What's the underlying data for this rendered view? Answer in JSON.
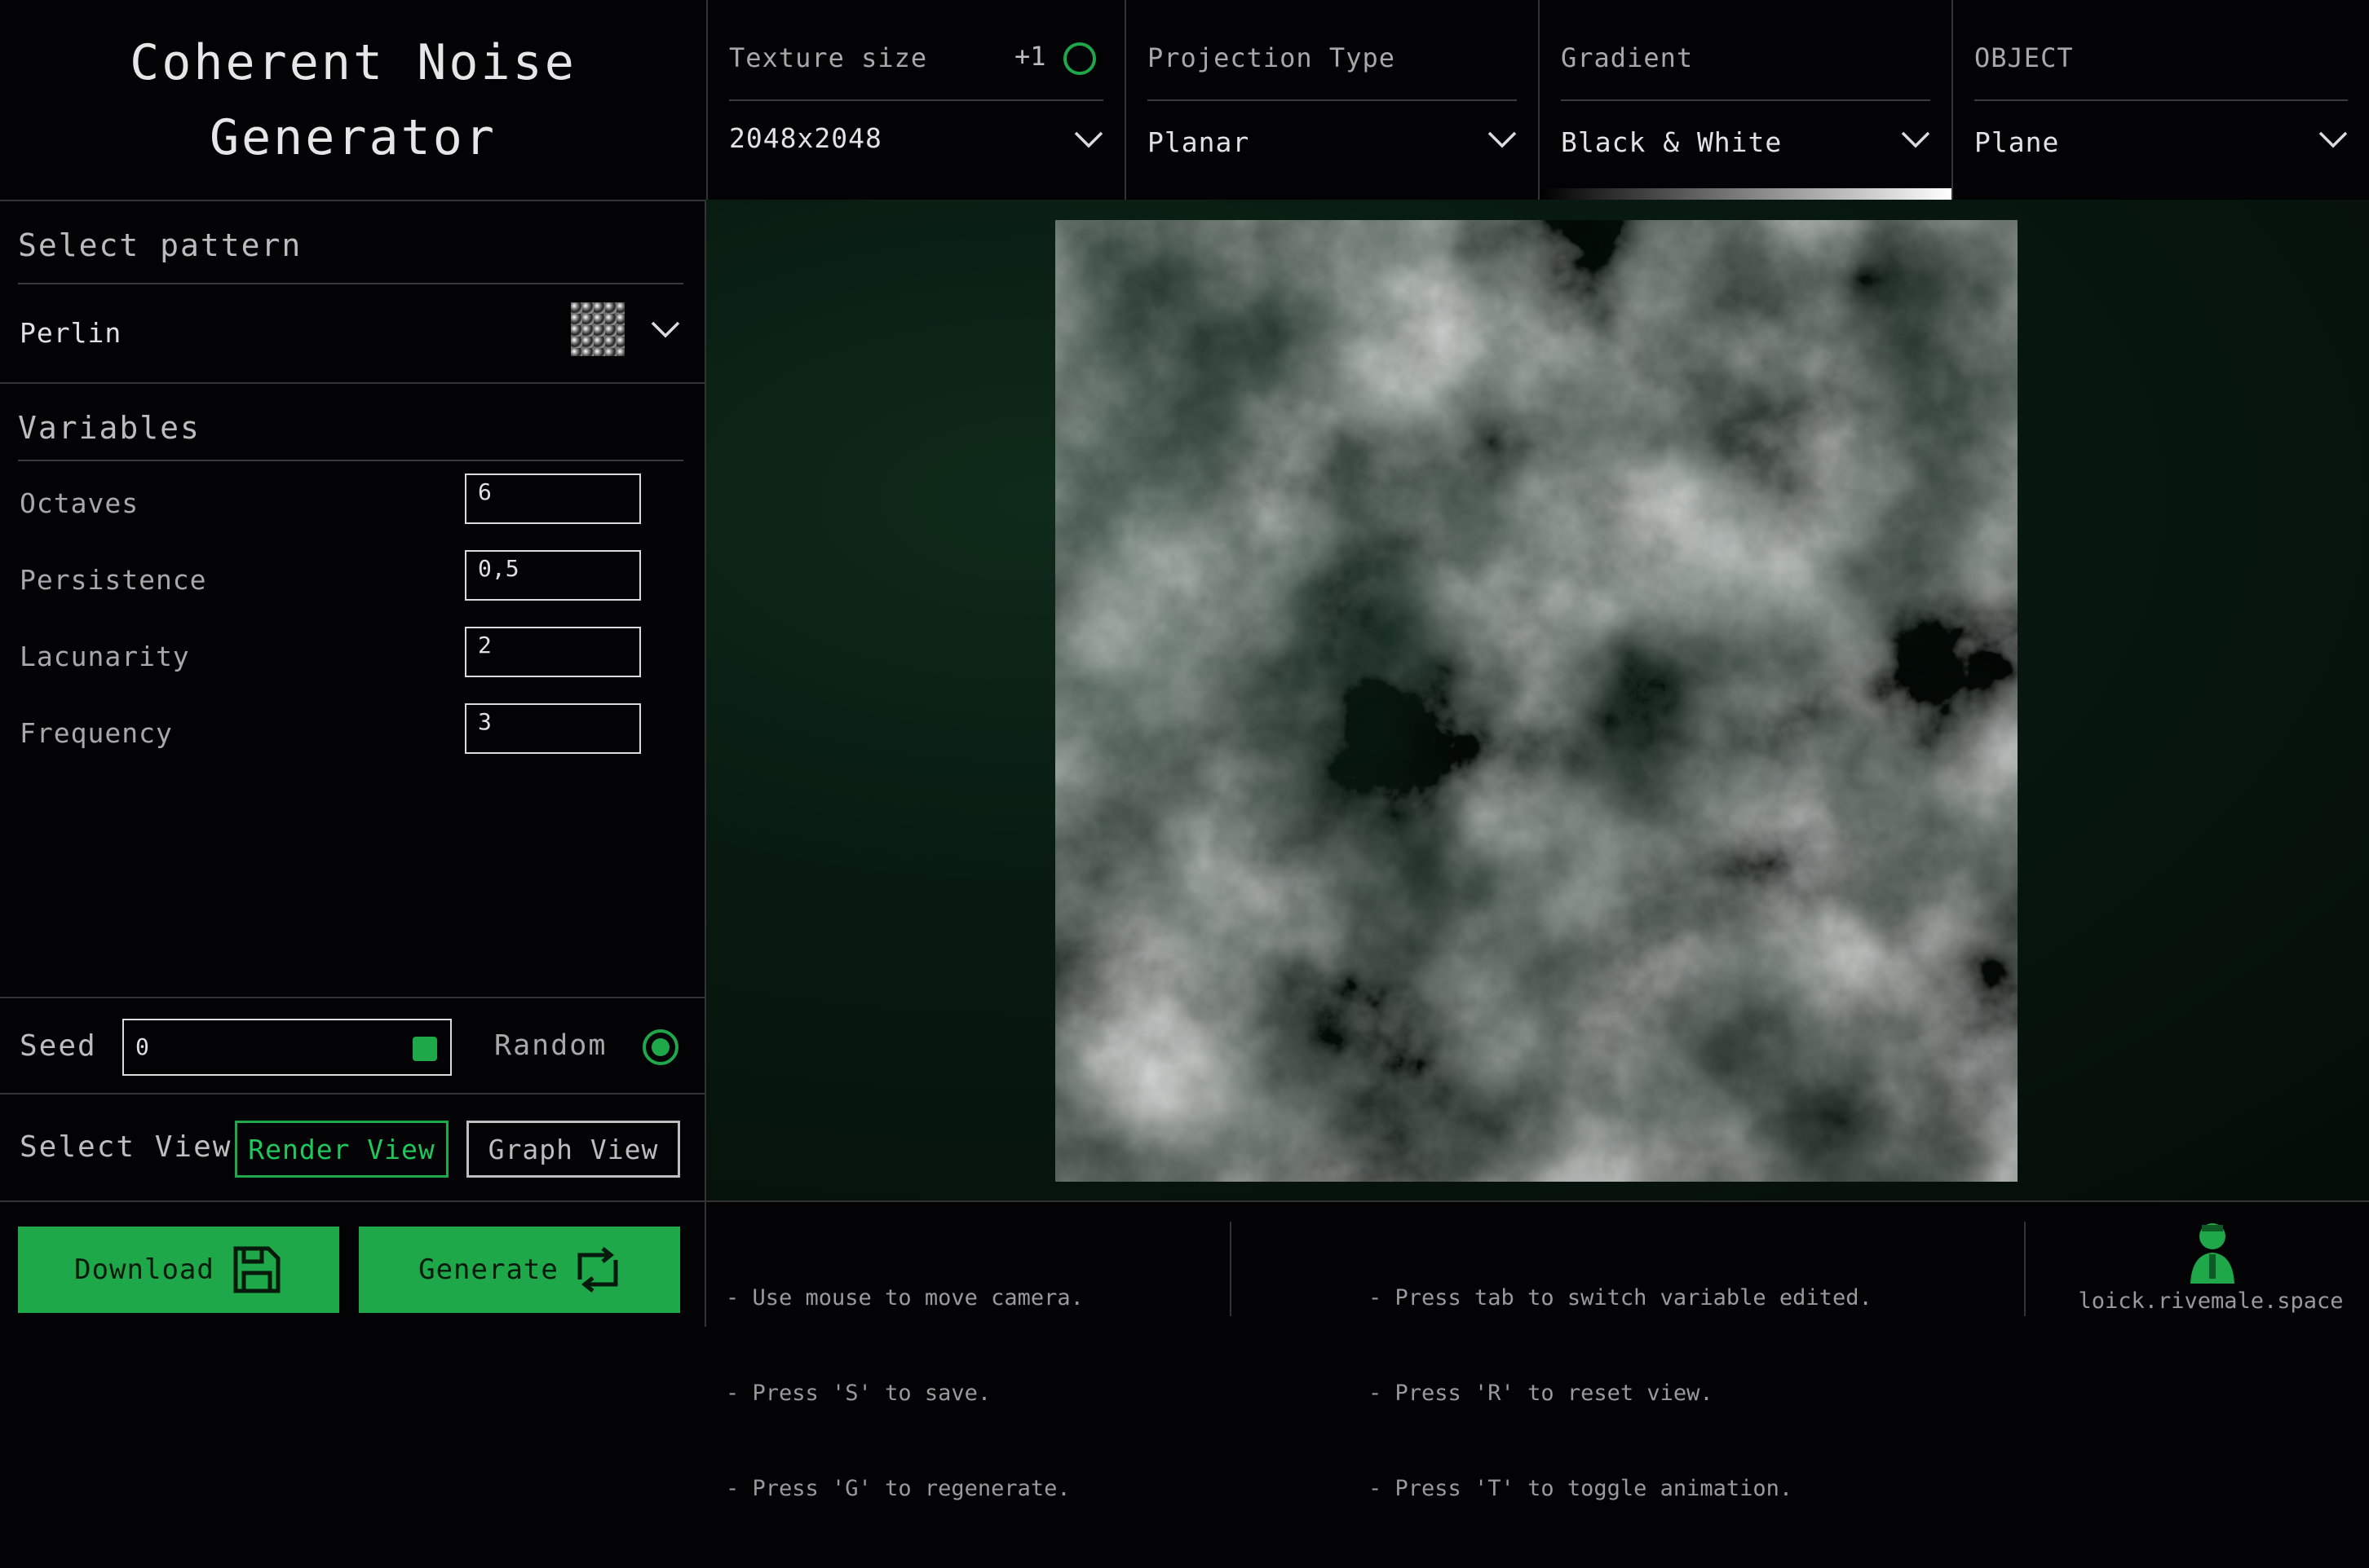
{
  "app": {
    "title": "Coherent Noise Generator"
  },
  "texture_size": {
    "label": "Texture size",
    "badge": "+1",
    "value": "2048x2048"
  },
  "projection": {
    "label": "Projection Type",
    "value": "Planar"
  },
  "gradient": {
    "label": "Gradient",
    "value": "Black & White"
  },
  "object": {
    "label": "OBJECT",
    "value": "Plane"
  },
  "pattern": {
    "section": "Select pattern",
    "value": "Perlin"
  },
  "variables": {
    "section": "Variables",
    "items": [
      {
        "label": "Octaves",
        "value": "6"
      },
      {
        "label": "Persistence",
        "value": "0,5"
      },
      {
        "label": "Lacunarity",
        "value": "2"
      },
      {
        "label": "Frequency",
        "value": "3"
      }
    ]
  },
  "seed": {
    "label": "Seed",
    "value": "0",
    "random_label": "Random"
  },
  "view": {
    "label": "Select View",
    "render": "Render View",
    "graph": "Graph View"
  },
  "actions": {
    "download": "Download",
    "generate": "Generate"
  },
  "hints": {
    "left": [
      "- Use mouse to move camera.",
      "- Press 'S' to save.",
      "- Press 'G' to regenerate."
    ],
    "right": [
      "- Press tab to switch variable edited.",
      "- Press 'R' to reset view.",
      "- Press 'T' to toggle animation."
    ]
  },
  "author": {
    "site": "loick.rivemale.space"
  },
  "colors": {
    "accent": "#1fa84a",
    "background": "#030305",
    "render_bg": "#081a10"
  }
}
